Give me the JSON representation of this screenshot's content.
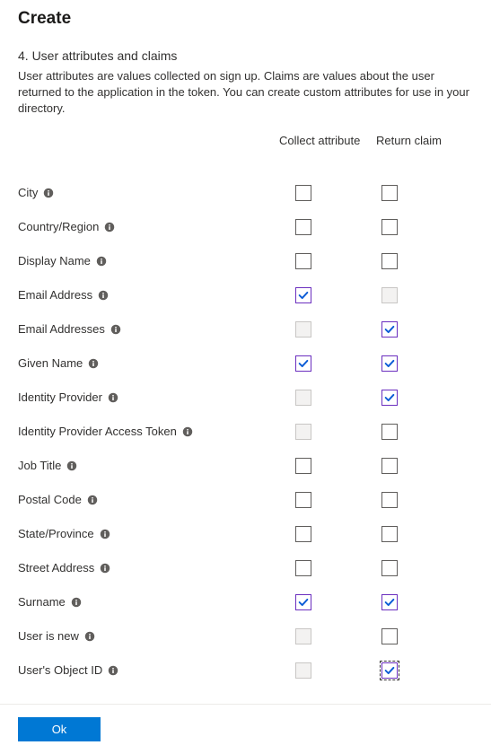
{
  "panel": {
    "title": "Create",
    "section_title": "4. User attributes and claims",
    "section_desc": "User attributes are values collected on sign up. Claims are values about the user returned to the application in the token. You can create custom attributes for use in your directory."
  },
  "headers": {
    "collect": "Collect attribute",
    "return": "Return claim"
  },
  "attributes": [
    {
      "label": "City",
      "collect": false,
      "collect_disabled": false,
      "return": false,
      "return_disabled": false,
      "return_focused": false
    },
    {
      "label": "Country/Region",
      "collect": false,
      "collect_disabled": false,
      "return": false,
      "return_disabled": false,
      "return_focused": false
    },
    {
      "label": "Display Name",
      "collect": false,
      "collect_disabled": false,
      "return": false,
      "return_disabled": false,
      "return_focused": false
    },
    {
      "label": "Email Address",
      "collect": true,
      "collect_disabled": false,
      "return": false,
      "return_disabled": true,
      "return_focused": false
    },
    {
      "label": "Email Addresses",
      "collect": false,
      "collect_disabled": true,
      "return": true,
      "return_disabled": false,
      "return_focused": false
    },
    {
      "label": "Given Name",
      "collect": true,
      "collect_disabled": false,
      "return": true,
      "return_disabled": false,
      "return_focused": false
    },
    {
      "label": "Identity Provider",
      "collect": false,
      "collect_disabled": true,
      "return": true,
      "return_disabled": false,
      "return_focused": false
    },
    {
      "label": "Identity Provider Access Token",
      "collect": false,
      "collect_disabled": true,
      "return": false,
      "return_disabled": false,
      "return_focused": false
    },
    {
      "label": "Job Title",
      "collect": false,
      "collect_disabled": false,
      "return": false,
      "return_disabled": false,
      "return_focused": false
    },
    {
      "label": "Postal Code",
      "collect": false,
      "collect_disabled": false,
      "return": false,
      "return_disabled": false,
      "return_focused": false
    },
    {
      "label": "State/Province",
      "collect": false,
      "collect_disabled": false,
      "return": false,
      "return_disabled": false,
      "return_focused": false
    },
    {
      "label": "Street Address",
      "collect": false,
      "collect_disabled": false,
      "return": false,
      "return_disabled": false,
      "return_focused": false
    },
    {
      "label": "Surname",
      "collect": true,
      "collect_disabled": false,
      "return": true,
      "return_disabled": false,
      "return_focused": false
    },
    {
      "label": "User is new",
      "collect": false,
      "collect_disabled": true,
      "return": false,
      "return_disabled": false,
      "return_focused": false
    },
    {
      "label": "User's Object ID",
      "collect": false,
      "collect_disabled": true,
      "return": true,
      "return_disabled": false,
      "return_focused": true
    }
  ],
  "footer": {
    "ok_label": "Ok"
  }
}
